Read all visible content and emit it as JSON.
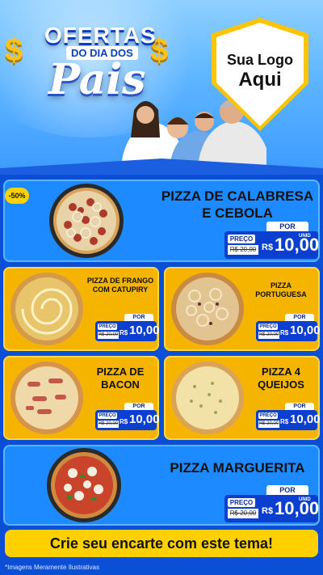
{
  "header": {
    "title_line1": "OFERTAS",
    "title_line2": "DO DIA DOS",
    "title_line3": "Pais",
    "logo_line1": "Sua Logo",
    "logo_line2": "Aqui",
    "accent_color": "#ffc400"
  },
  "badge": "-50%",
  "products": [
    {
      "name": "PIZZA DE CALABRESA E CEBOLA",
      "por": "POR",
      "preco": "PREÇO",
      "old_price": "R$ 20,00",
      "currency": "R$",
      "price": "10,00",
      "unit": "UNID"
    },
    {
      "name": "PIZZA DE FRANGO COM CATUPIRY",
      "por": "POR",
      "preco": "PREÇO",
      "old_price": "R$ 20,00",
      "currency": "R$",
      "price": "10,00",
      "unit": "UNID"
    },
    {
      "name": "PIZZA PORTUGUESA",
      "por": "POR",
      "preco": "PREÇO",
      "old_price": "R$ 20,00",
      "currency": "R$",
      "price": "10,00",
      "unit": "UNID"
    },
    {
      "name": "PIZZA DE BACON",
      "por": "POR",
      "preco": "PREÇO",
      "old_price": "R$ 20,00",
      "currency": "R$",
      "price": "10,00",
      "unit": "UNID"
    },
    {
      "name": "PIZZA 4 QUEIJOS",
      "por": "POR",
      "preco": "PREÇO",
      "old_price": "R$ 20,00",
      "currency": "R$",
      "price": "10,00",
      "unit": "UNID"
    },
    {
      "name": "PIZZA MARGUERITA",
      "por": "POR",
      "preco": "PREÇO",
      "old_price": "R$ 20,00",
      "currency": "R$",
      "price": "10,00",
      "unit": "UNID"
    }
  ],
  "cta": "Crie seu encarte com este tema!",
  "disclaimer": "*Imagens Meramente Ilustrativas",
  "colors": {
    "blue_card": "#1d8bff",
    "yellow_card": "#f5b400",
    "price_box": "#0a3fd0",
    "background": "#0b4fd6"
  }
}
